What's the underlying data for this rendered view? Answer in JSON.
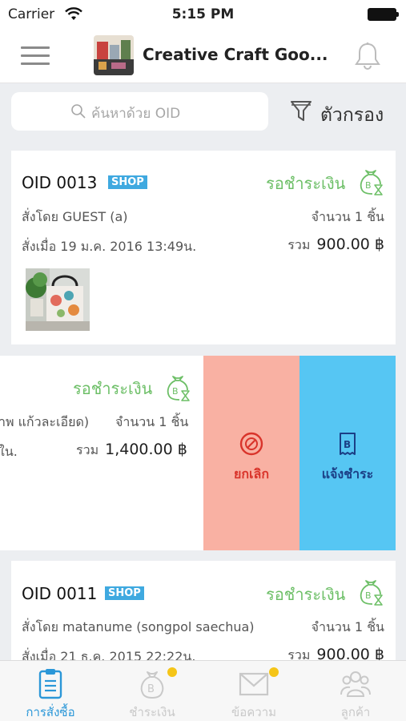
{
  "status_bar": {
    "carrier": "Carrier",
    "time": "5:15 PM"
  },
  "header": {
    "shop_name": "Creative Craft Goo..."
  },
  "search": {
    "placeholder": "ค้นหาด้วย OID"
  },
  "filter": {
    "label": "ตัวกรอง"
  },
  "orders": [
    {
      "oid": "OID 0013",
      "badge": "SHOP",
      "status": "รอชำระเงิน",
      "ordered_by": "สั่งโดย GUEST (a)",
      "quantity": "จำนวน 1 ชิ้น",
      "ordered_at": "สั่งเมื่อ 19 ม.ค. 2016 13:49น.",
      "total_label": "รวม",
      "total_value": "900.00 ฿"
    },
    {
      "status": "รอชำระเงิน",
      "ordered_by": "าพ แก้วละเอียด)",
      "quantity": "จำนวน 1 ชิ้น",
      "ordered_at": "ใน.",
      "total_label": "รวม",
      "total_value": "1,400.00 ฿"
    },
    {
      "oid": "OID 0011",
      "badge": "SHOP",
      "status": "รอชำระเงิน",
      "ordered_by": "สั่งโดย matanume (songpol saechua)",
      "quantity": "จำนวน 1 ชิ้น",
      "ordered_at": "สั่งเมื่อ 21 ธ.ค. 2015 22:22น.",
      "total_label": "รวม",
      "total_value": "900.00 ฿"
    }
  ],
  "swipe_actions": {
    "cancel": "ยกเลิก",
    "notify_payment": "แจ้งชำระ"
  },
  "tabs": [
    {
      "label": "การสั่งซื้อ",
      "icon": "clipboard-icon",
      "active": true
    },
    {
      "label": "ชำระเงิน",
      "icon": "money-bag-icon",
      "badge_dot": true
    },
    {
      "label": "ข้อความ",
      "icon": "envelope-icon",
      "badge_dot": true
    },
    {
      "label": "ลูกค้า",
      "icon": "customers-icon"
    }
  ],
  "colors": {
    "status_green": "#6dbf67",
    "shop_badge": "#3fa9e0",
    "cancel_bg": "#f9b1a3",
    "cancel_text": "#d9342b",
    "pay_bg": "#56c6f3",
    "pay_text": "#1b3f86",
    "tab_active": "#2b97d8",
    "notification_dot": "#f5c518"
  }
}
